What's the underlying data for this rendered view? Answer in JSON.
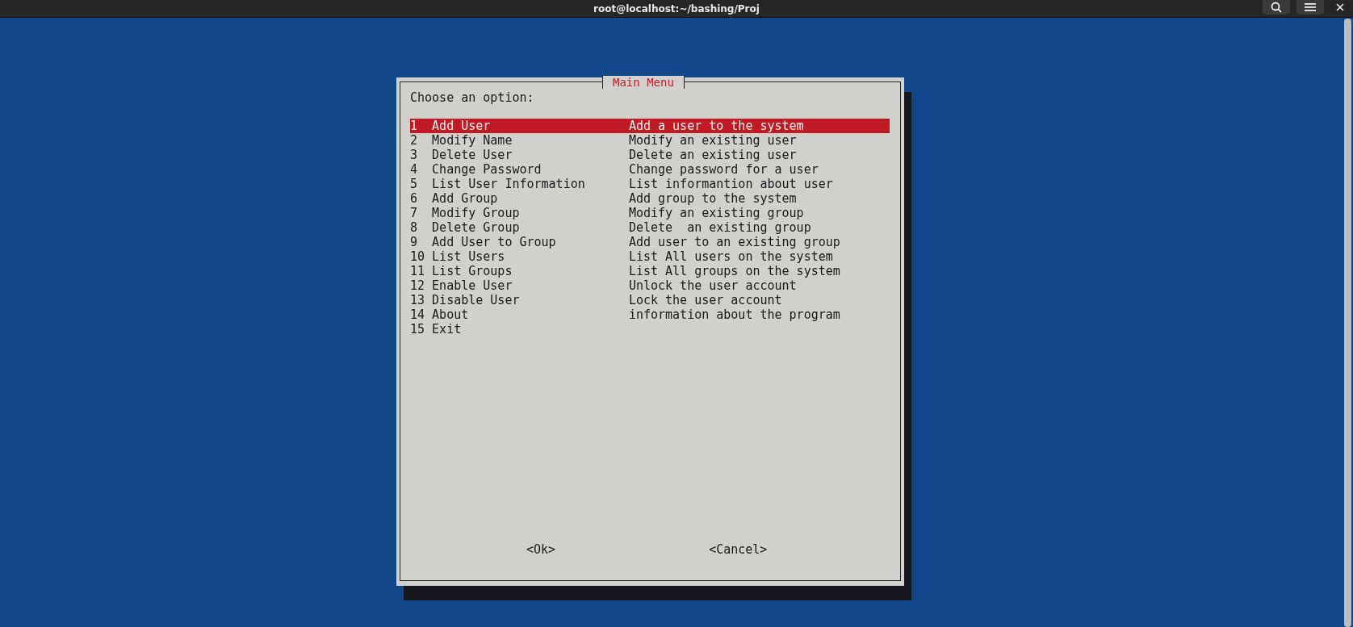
{
  "window": {
    "title": "root@localhost:~/bashing/Proj"
  },
  "dialog": {
    "title": "Main Menu",
    "prompt": "Choose an option:",
    "items": [
      {
        "number": "1",
        "label": "Add User",
        "description": "Add a user to the system",
        "selected": true
      },
      {
        "number": "2",
        "label": "Modify Name",
        "description": "Modify an existing user",
        "selected": false
      },
      {
        "number": "3",
        "label": "Delete User",
        "description": "Delete an existing user",
        "selected": false
      },
      {
        "number": "4",
        "label": "Change Password",
        "description": "Change password for a user",
        "selected": false
      },
      {
        "number": "5",
        "label": "List User Information",
        "description": "List informantion about user",
        "selected": false
      },
      {
        "number": "6",
        "label": "Add Group",
        "description": "Add group to the system",
        "selected": false
      },
      {
        "number": "7",
        "label": "Modify Group",
        "description": "Modify an existing group",
        "selected": false
      },
      {
        "number": "8",
        "label": "Delete Group",
        "description": "Delete  an existing group",
        "selected": false
      },
      {
        "number": "9",
        "label": "Add User to Group",
        "description": "Add user to an existing group",
        "selected": false
      },
      {
        "number": "10",
        "label": "List Users",
        "description": "List All users on the system",
        "selected": false
      },
      {
        "number": "11",
        "label": "List Groups",
        "description": "List All groups on the system",
        "selected": false
      },
      {
        "number": "12",
        "label": "Enable User",
        "description": "Unlock the user account",
        "selected": false
      },
      {
        "number": "13",
        "label": "Disable User",
        "description": "Lock the user account",
        "selected": false
      },
      {
        "number": "14",
        "label": "About",
        "description": "information about the program",
        "selected": false
      },
      {
        "number": "15",
        "label": "Exit",
        "selected": false
      }
    ],
    "buttons": [
      {
        "label": "<Ok>"
      },
      {
        "label": "<Cancel>"
      }
    ]
  }
}
